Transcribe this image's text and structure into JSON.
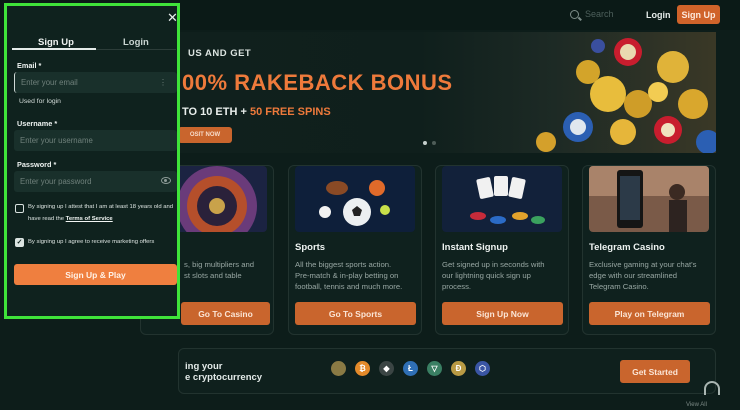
{
  "header": {
    "search_placeholder": "Search",
    "login_label": "Login",
    "signup_label": "Sign Up"
  },
  "hero": {
    "line1": "US AND GET",
    "line2": "00% RAKEBACK BONUS",
    "line3_prefix": "TO 10 ETH + ",
    "line3_highlight": "50 FREE SPINS",
    "cta_label": "OSIT NOW",
    "slide_count": 2,
    "active_slide": 1
  },
  "cards": [
    {
      "title": "",
      "desc": "s, big multipliers and\nst slots and table",
      "button": "Go To Casino"
    },
    {
      "title": "Sports",
      "desc": "All the biggest sports action.\nPre-match & in-play betting on\nfootball, tennis and much more.",
      "button": "Go To Sports"
    },
    {
      "title": "Instant Signup",
      "desc": "Get signed up in seconds with\nour lightning quick sign up\nprocess.",
      "button": "Sign Up Now"
    },
    {
      "title": "Telegram Casino",
      "desc": "Exclusive gaming at your chat's\nedge with our streamlined\nTelegram Casino.",
      "button": "Play on Telegram"
    }
  ],
  "crypto_strip": {
    "line1": "ing your",
    "line2": "e cryptocurrency",
    "button": "Get Started",
    "coins": [
      {
        "icon": "usdc-coin-icon",
        "glyph": "",
        "color": "#8a7a44"
      },
      {
        "icon": "bitcoin-icon",
        "glyph": "₿",
        "color": "#e48a2a"
      },
      {
        "icon": "ethereum-icon",
        "glyph": "◆",
        "color": "#3b4544"
      },
      {
        "icon": "litecoin-icon",
        "glyph": "Ł",
        "color": "#2f6fb5"
      },
      {
        "icon": "tron-icon",
        "glyph": "▽",
        "color": "#3a7f63"
      },
      {
        "icon": "dogecoin-icon",
        "glyph": "Ð",
        "color": "#b99a44"
      },
      {
        "icon": "chainlink-icon",
        "glyph": "⬡",
        "color": "#3a55a4"
      }
    ]
  },
  "footer_link": "View All",
  "modal": {
    "tab_signup": "Sign Up",
    "tab_login": "Login",
    "email_label": "Email *",
    "email_placeholder": "Enter your email",
    "email_hint": "Used for login",
    "username_label": "Username *",
    "username_placeholder": "Enter your username",
    "password_label": "Password *",
    "password_placeholder": "Enter your password",
    "age_text": "By signing up I attest that I am at least 18 years old and have read the ",
    "terms_link": "Terms of Service",
    "marketing_text": "By signing up I agree to receive marketing offers",
    "submit_label": "Sign Up & Play",
    "age_checked": false,
    "marketing_checked": true
  },
  "colors": {
    "accent": "#ef7f3f",
    "highlight_border": "#3fe33a",
    "background": "#0d1d1a"
  }
}
